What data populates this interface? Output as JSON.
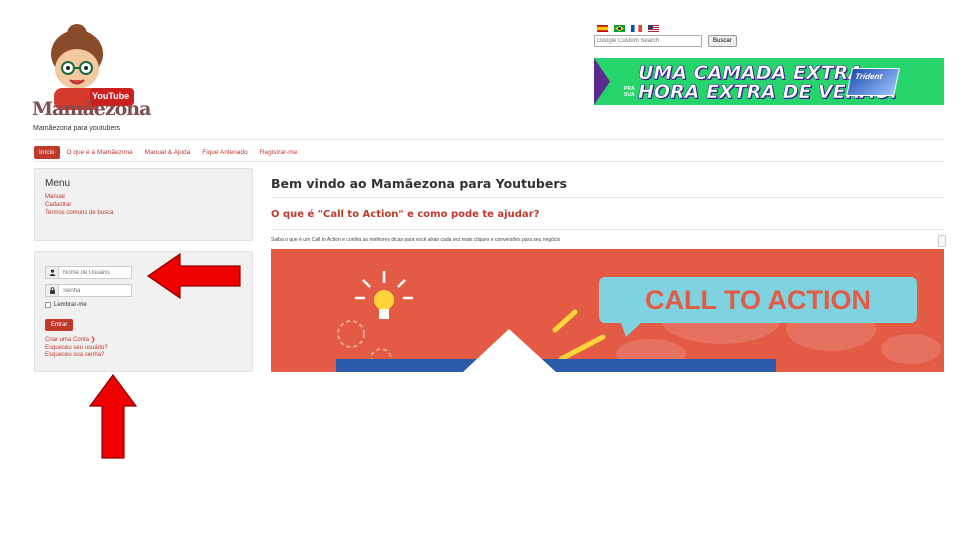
{
  "header": {
    "logo_word": "Mamãezona",
    "logo_badge": "YouTube",
    "tagline": "Mamãezona para youtubers"
  },
  "languages": [
    {
      "icon": "flag-es-icon"
    },
    {
      "icon": "flag-br-icon"
    },
    {
      "icon": "flag-fr-icon"
    },
    {
      "icon": "flag-us-icon"
    }
  ],
  "search": {
    "placeholder": "Google Custom Search",
    "button_label": "Buscar"
  },
  "ad": {
    "line1": "UMA CAMADA EXTRA",
    "line2": "HORA EXTRA DE VERÃO.",
    "small_tag": "PRA SUA",
    "product": "Trident"
  },
  "nav": {
    "items": [
      {
        "label": "Início"
      },
      {
        "label": "O que é a Mamãezona"
      },
      {
        "label": "Manual & Ajuda"
      },
      {
        "label": "Fique Antenado"
      },
      {
        "label": "Registrar-me"
      }
    ]
  },
  "sidebar": {
    "menu_title": "Menu",
    "menu_links": [
      {
        "label": "Manual"
      },
      {
        "label": "Cadastrar"
      },
      {
        "label": "Termos comuns de busca"
      }
    ]
  },
  "login": {
    "username_placeholder": "Nome de Usuário",
    "password_placeholder": "Senha",
    "remember_label": "Lembrar-me",
    "submit_label": "Entrar",
    "links": [
      {
        "label": "Criar uma Conta ❯"
      },
      {
        "label": "Esqueceu seu usuário?"
      },
      {
        "label": "Esqueceu sua senha?"
      }
    ]
  },
  "main": {
    "welcome": "Bem vindo ao Mamãezona para Youtubers",
    "article_title": "O que é \"Call to Action\" e como pode te ajudar?",
    "intro": "Saiba o que é um Call to Action e confira as melhores dicas para você atrair cada vez mais cliques e conversões para seu negócio",
    "hero_text": "CALL TO ACTION"
  },
  "colors": {
    "accent": "#c0392b",
    "hero_bg": "#e35b45",
    "ad_bg": "#26d46c",
    "arrow": "#ee0000"
  }
}
